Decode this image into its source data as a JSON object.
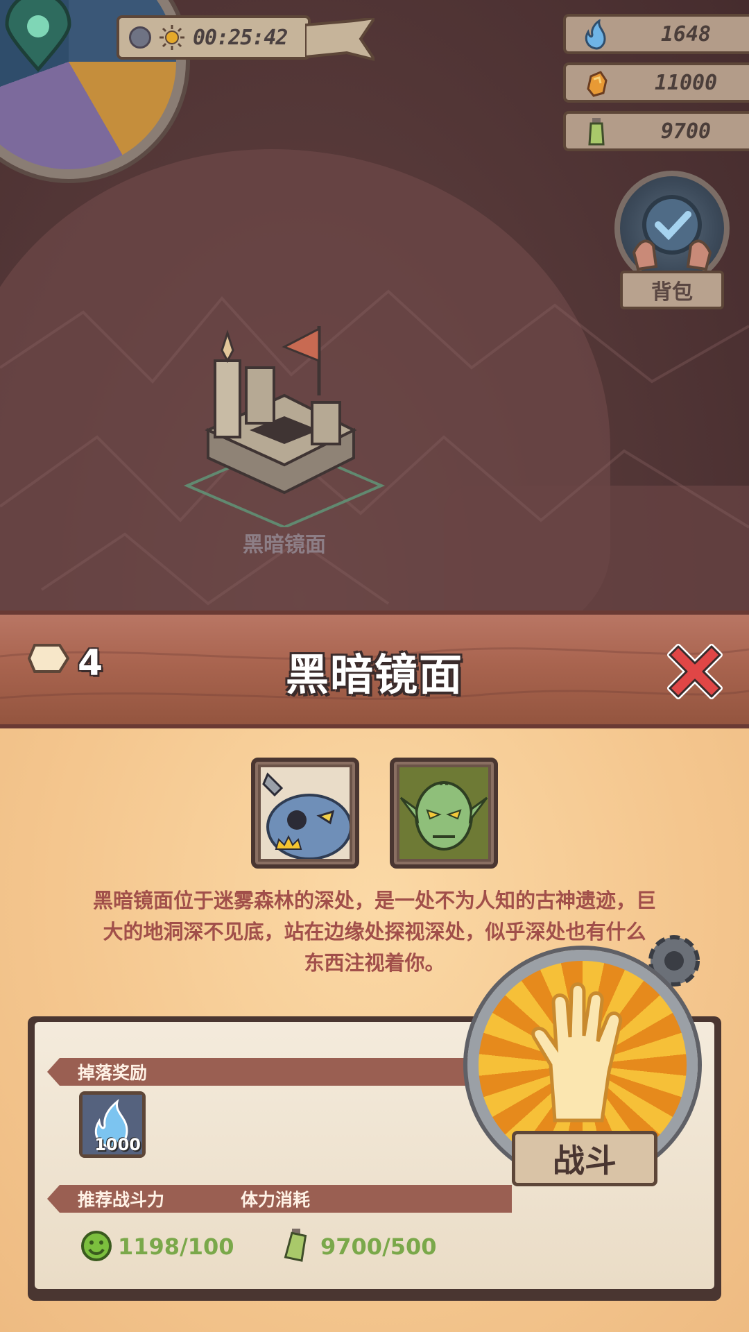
{
  "hud": {
    "timer": "00:25:42",
    "resources": [
      {
        "name": "spirit-flame",
        "value": "1648"
      },
      {
        "name": "gold-ore",
        "value": "11000"
      },
      {
        "name": "stamina-potion",
        "value": "9700"
      }
    ],
    "bag_label": "背包"
  },
  "map": {
    "location_name": "黑暗镜面"
  },
  "panel": {
    "stage_number": "4",
    "title": "黑暗镜面",
    "description_lines": [
      "黑暗镜面位于迷雾森林的深处，是一处不为人知的古神遗迹，巨",
      "大的地洞深不见底，站在边缘处探视深处，似乎深处也有什么",
      "东西注视着你。"
    ],
    "enemies": [
      {
        "icon": "blue-goblin-boss-portrait",
        "boss": true
      },
      {
        "icon": "green-goblin-portrait",
        "boss": false
      }
    ],
    "drop_label": "掉落奖励",
    "drop_items": [
      {
        "icon": "spirit-flame-icon",
        "quantity": "1000"
      }
    ],
    "recommended_power_label": "推荐战斗力",
    "recommended_power_value": "1198/100",
    "stamina_cost_label": "体力消耗",
    "stamina_cost_value": "9700/500",
    "fight_label": "战斗"
  },
  "colors": {
    "accent_text": "#a14f4a",
    "stat_green": "#7aa84a",
    "wood": "#a9644f",
    "parchment": "#f4c68e"
  }
}
